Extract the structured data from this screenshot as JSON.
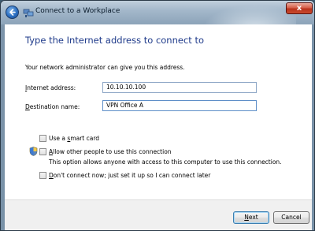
{
  "window": {
    "title": "Connect to a Workplace",
    "close_glyph": "x"
  },
  "heading": "Type the Internet address to connect to",
  "subtext": "Your network administrator can give you this address.",
  "fields": {
    "internet_address": {
      "label_prefix": "I",
      "label_rest": "nternet address:",
      "value": "10.10.10.100"
    },
    "destination_name": {
      "label_prefix": "D",
      "label_rest": "estination name:",
      "value": "VPN Office A"
    }
  },
  "options": {
    "smart_card": {
      "pre": "Use a ",
      "key": "s",
      "post": "mart card",
      "checked": false
    },
    "allow_others": {
      "pre": "",
      "key": "A",
      "post": "llow other people to use this connection",
      "hint": "This option allows anyone with access to this computer to use this connection.",
      "checked": false
    },
    "dont_connect": {
      "pre": "",
      "key": "D",
      "post": "on't connect now; just set it up so I can connect later",
      "checked": false
    }
  },
  "buttons": {
    "next": {
      "key": "N",
      "rest": "ext"
    },
    "cancel": "Cancel"
  },
  "icons": {
    "back": "back-arrow-icon",
    "title": "network-connection-icon",
    "shield": "uac-shield-icon"
  }
}
